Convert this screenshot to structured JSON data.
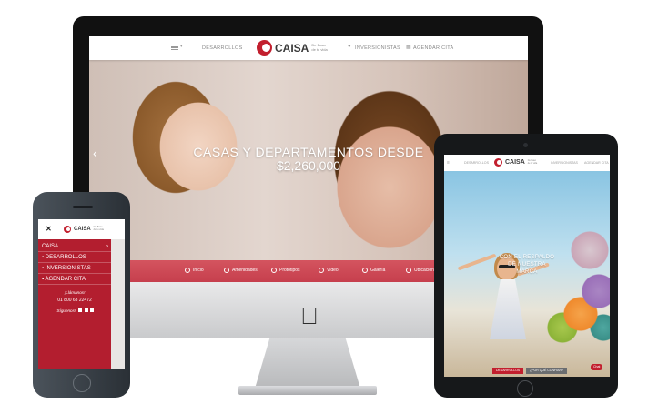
{
  "colors": {
    "brand_red": "#c21f2e",
    "bar_red": "#cf4a57",
    "dark": "#111111"
  },
  "brand": {
    "name": "CAISA",
    "tagline_line1": "De Baso",
    "tagline_line2": "de tu vida"
  },
  "desktop": {
    "nav": {
      "menu_icon": "hamburger-icon",
      "desarrollos": "DESARROLLOS",
      "inversionistas": "INVERSIONISTAS",
      "agendar": "AGENDAR CITA"
    },
    "hero": {
      "line1": "CASAS Y DEPARTAMENTOS DESDE",
      "line2": "$2,260,000",
      "prev_arrow": "‹"
    },
    "bottom_bar": [
      {
        "label": "Inicio",
        "icon": "home-icon"
      },
      {
        "label": "Amenidades",
        "icon": "amenities-icon"
      },
      {
        "label": "Prototipos",
        "icon": "prototypes-icon"
      },
      {
        "label": "Video",
        "icon": "video-icon"
      },
      {
        "label": "Galería",
        "icon": "gallery-icon"
      },
      {
        "label": "Ubicación",
        "icon": "location-icon"
      }
    ]
  },
  "phone": {
    "close": "✕",
    "menu": [
      {
        "label": "CAISA",
        "arrow": "›"
      },
      {
        "label": "DESARROLLOS"
      },
      {
        "label": "INVERSIONISTAS"
      },
      {
        "label": "AGENDAR CITA"
      }
    ],
    "call_label": "¡Llámanos!",
    "phone_number": "01 800 63 22472",
    "follow_label": "¡Síguenos!"
  },
  "tablet": {
    "nav": {
      "menu_icon": "hamburger-icon",
      "desarrollos": "DESARROLLOS",
      "inversionistas": "INVERSIONISTAS",
      "agendar": "AGENDAR CITA"
    },
    "hero": {
      "line1": "CON EL RESPALDO",
      "line2": "DE NUESTRA",
      "line3": "MARCA"
    },
    "buttons": {
      "primary": "DESARROLLOS",
      "secondary": "¿POR QUÉ CONFIAR?"
    },
    "chat": "Chat"
  }
}
